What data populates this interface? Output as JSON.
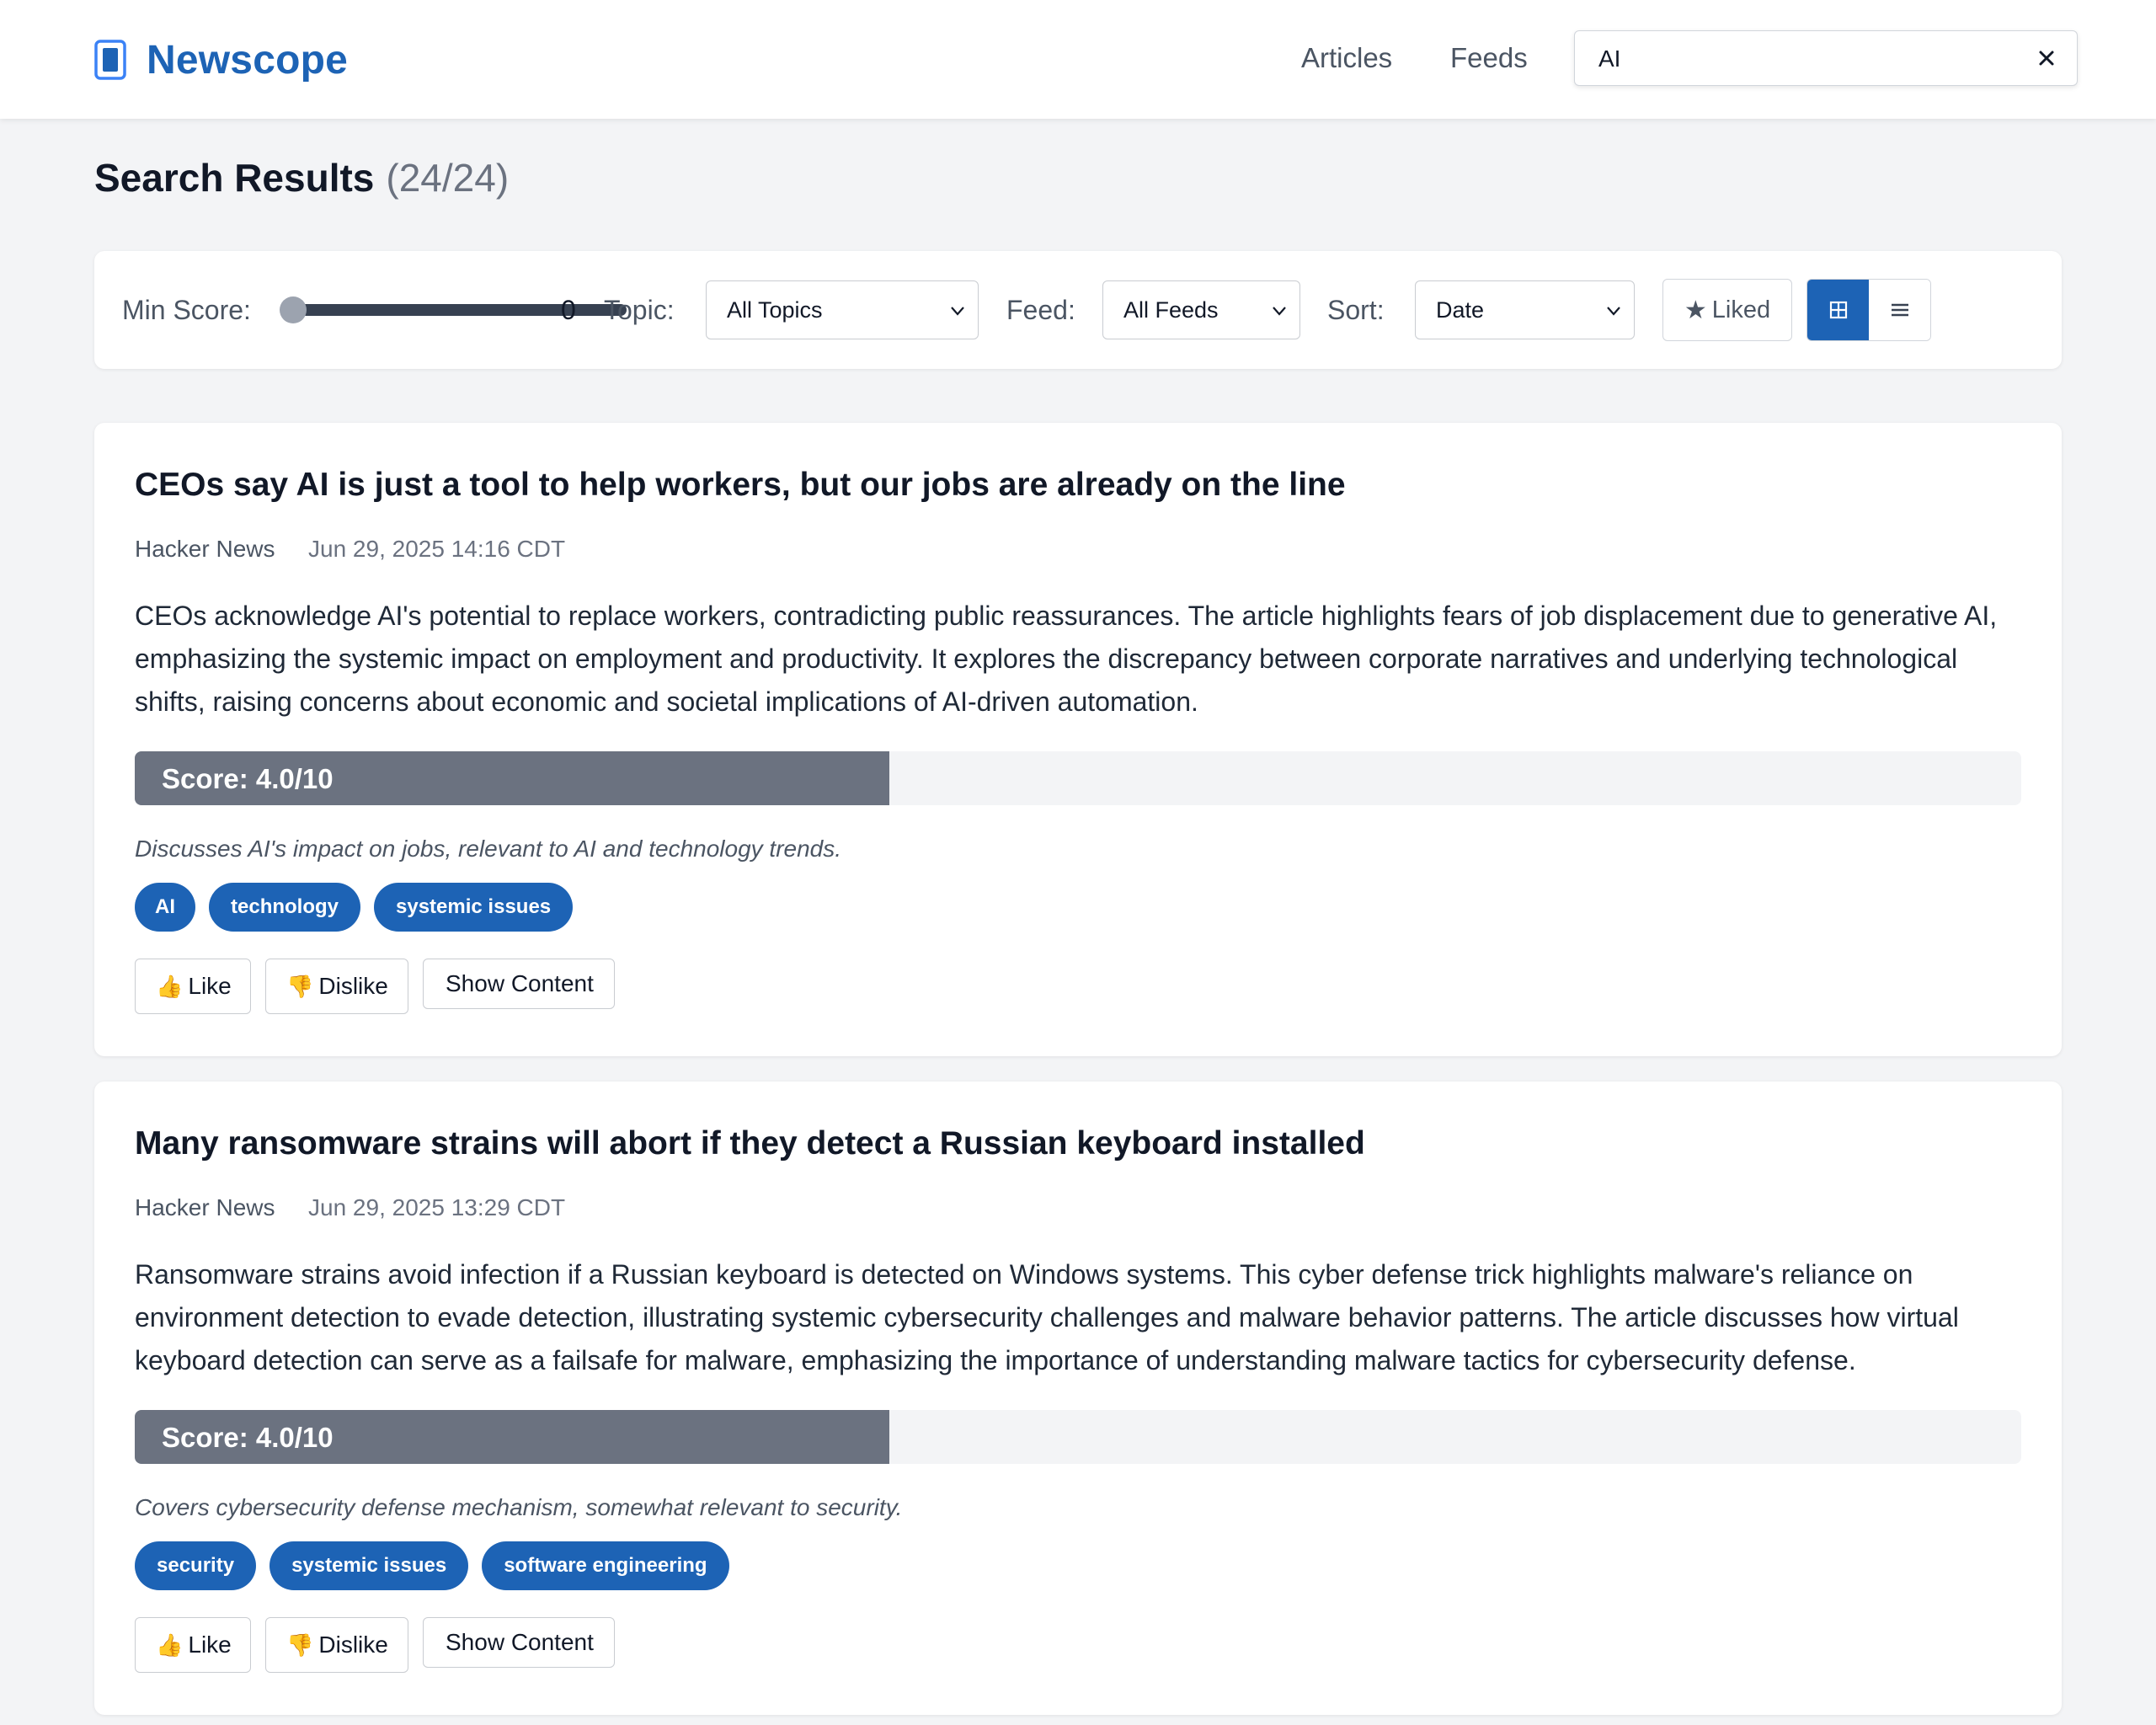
{
  "header": {
    "app_name": "Newscope",
    "nav": {
      "articles": "Articles",
      "feeds": "Feeds"
    },
    "search": {
      "value": "AI",
      "clear_icon": "close-icon"
    }
  },
  "page": {
    "title": "Search Results",
    "count": "(24/24)"
  },
  "filters": {
    "min_score_label": "Min Score:",
    "min_score_value": "0",
    "topic_label": "Topic:",
    "topic_selected": "All Topics",
    "feed_label": "Feed:",
    "feed_selected": "All Feeds",
    "sort_label": "Sort:",
    "sort_selected": "Date",
    "liked_label": "Liked",
    "view_mode": "grid"
  },
  "articles": [
    {
      "title": "CEOs say AI is just a tool to help workers, but our jobs are already on the line",
      "source": "Hacker News",
      "date": "Jun 29, 2025 14:16 CDT",
      "summary": "CEOs acknowledge AI's potential to replace workers, contradicting public reassurances. The article highlights fears of job displacement due to generative AI, emphasizing the systemic impact on employment and productivity. It explores the discrepancy between corporate narratives and underlying technological shifts, raising concerns about economic and societal implications of AI-driven automation.",
      "score_text": "Score: 4.0/10",
      "score": 4.0,
      "reason": "Discusses AI's impact on jobs, relevant to AI and technology trends.",
      "tags": [
        "AI",
        "technology",
        "systemic issues"
      ],
      "like_label": "Like",
      "dislike_label": "Dislike",
      "show_label": "Show Content"
    },
    {
      "title": "Many ransomware strains will abort if they detect a Russian keyboard installed",
      "source": "Hacker News",
      "date": "Jun 29, 2025 13:29 CDT",
      "summary": "Ransomware strains avoid infection if a Russian keyboard is detected on Windows systems. This cyber defense trick highlights malware's reliance on environment detection to evade detection, illustrating systemic cybersecurity challenges and malware behavior patterns. The article discusses how virtual keyboard detection can serve as a failsafe for malware, emphasizing the importance of understanding malware tactics for cybersecurity defense.",
      "score_text": "Score: 4.0/10",
      "score": 4.0,
      "reason": "Covers cybersecurity defense mechanism, somewhat relevant to security.",
      "tags": [
        "security",
        "systemic issues",
        "software engineering"
      ],
      "like_label": "Like",
      "dislike_label": "Dislike",
      "show_label": "Show Content"
    }
  ],
  "colors": {
    "brand": "#1d63b5",
    "score_fill": "#6b7280",
    "background": "#f3f4f6"
  }
}
